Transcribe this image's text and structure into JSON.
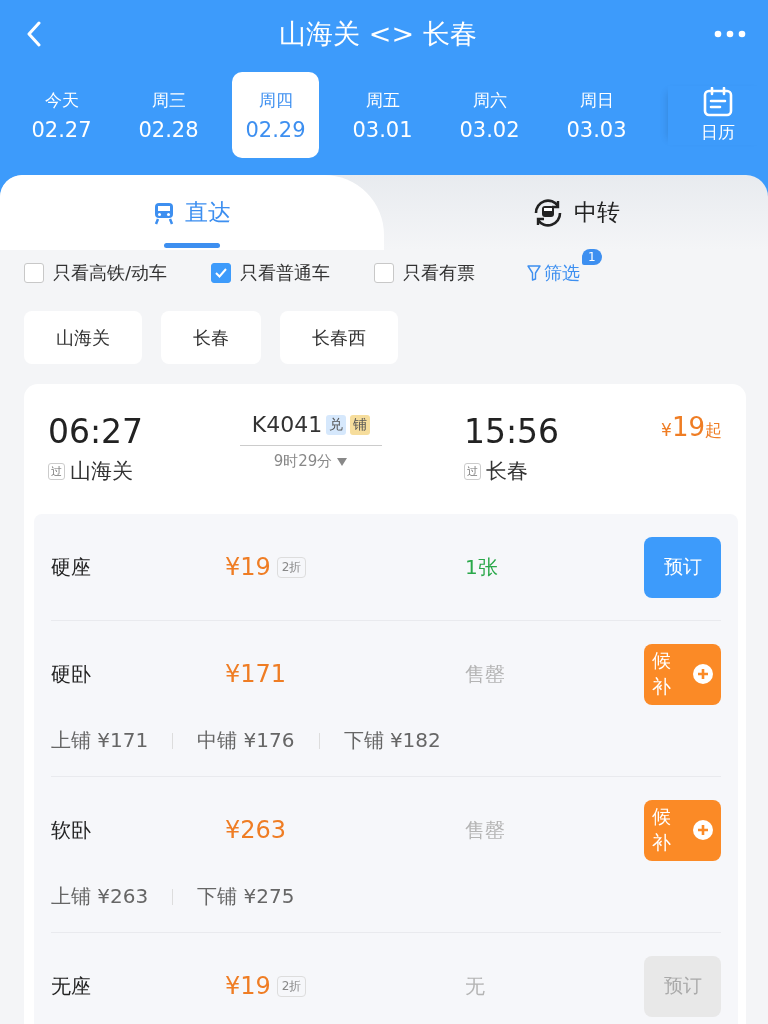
{
  "header": {
    "title": "山海关 <> 长春"
  },
  "dates": [
    {
      "weekday": "今天",
      "date": "02.27",
      "selected": false
    },
    {
      "weekday": "周三",
      "date": "02.28",
      "selected": false
    },
    {
      "weekday": "周四",
      "date": "02.29",
      "selected": true
    },
    {
      "weekday": "周五",
      "date": "03.01",
      "selected": false
    },
    {
      "weekday": "周六",
      "date": "03.02",
      "selected": false
    },
    {
      "weekday": "周日",
      "date": "03.03",
      "selected": false
    }
  ],
  "calendar": {
    "label": "日历"
  },
  "modes": [
    {
      "kind": "direct",
      "label": "直达",
      "selected": true
    },
    {
      "kind": "transfer",
      "label": "中转",
      "selected": false
    }
  ],
  "filters": [
    {
      "label": "只看高铁/动车",
      "checked": false
    },
    {
      "label": "只看普通车",
      "checked": true
    },
    {
      "label": "只看有票",
      "checked": false
    }
  ],
  "filter_button": {
    "label": "筛选",
    "badge": "1"
  },
  "stations": [
    "山海关",
    "长春",
    "长春西"
  ],
  "train": {
    "depart_time": "06:27",
    "depart_tag": "过",
    "depart_station": "山海关",
    "train_no": "K4041",
    "tags": [
      {
        "label": "兑",
        "color": "#d6e8fc"
      },
      {
        "label": "铺",
        "color": "#f6dd9c"
      }
    ],
    "duration": "9时29分",
    "arrive_time": "15:56",
    "arrive_tag": "过",
    "arrive_station": "长春",
    "currency": "¥",
    "price": "19",
    "price_suffix": "起"
  },
  "seats": [
    {
      "name": "硬座",
      "price": "¥19",
      "discount": "2折",
      "availability": "1张",
      "color": "#2aa84a",
      "action": {
        "kind": "book",
        "label": "预订",
        "disabled": false
      }
    },
    {
      "name": "硬卧",
      "price": "¥171",
      "availability": "售罄",
      "color": "#b4b4b4",
      "action": {
        "kind": "waitlist",
        "label": "候补"
      },
      "berths": [
        "上铺 ¥171",
        "中铺 ¥176",
        "下铺 ¥182"
      ]
    },
    {
      "name": "软卧",
      "price": "¥263",
      "availability": "售罄",
      "color": "#b4b4b4",
      "action": {
        "kind": "waitlist",
        "label": "候补"
      },
      "berths": [
        "上铺 ¥263",
        "下铺 ¥275"
      ]
    },
    {
      "name": "无座",
      "price": "¥19",
      "discount": "2折",
      "availability": "无",
      "color": "#b4b4b4",
      "action": {
        "kind": "book",
        "label": "预订",
        "disabled": true
      }
    }
  ]
}
